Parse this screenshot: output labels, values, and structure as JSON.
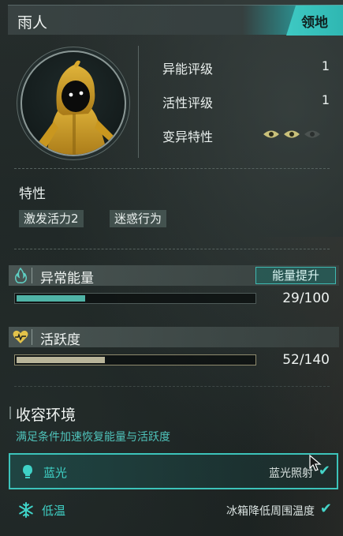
{
  "header": {
    "title": "雨人",
    "tag": "领地"
  },
  "portrait": {
    "icon": "yellow-raincoat-character"
  },
  "stats": [
    {
      "label": "异能评级",
      "value": "1"
    },
    {
      "label": "活性评级",
      "value": "1"
    },
    {
      "label": "变异特性",
      "value": ""
    }
  ],
  "mutation_eyes": {
    "active": 2,
    "total": 3
  },
  "traits": {
    "title": "特性",
    "items": [
      "激发活力2",
      "迷惑行为"
    ]
  },
  "energy": {
    "title": "异常能量",
    "boost_label": "能量提升",
    "current": 29,
    "max": 100,
    "text": "29/100",
    "color": "#4fb3a6",
    "icon": "flame-icon"
  },
  "activity": {
    "title": "活跃度",
    "current": 52,
    "max": 140,
    "text": "52/140",
    "color": "#b9b59a",
    "icon": "heart-pulse-icon"
  },
  "containment": {
    "title": "收容环境",
    "description": "满足条件加速恢复能量与活跃度",
    "conditions": [
      {
        "name": "蓝光",
        "description": "蓝光照射",
        "icon": "lightbulb-icon",
        "met": true,
        "selected": true
      },
      {
        "name": "低温",
        "description": "冰箱降低周围温度",
        "icon": "snowflake-icon",
        "met": true,
        "selected": false
      }
    ]
  },
  "colors": {
    "accent": "#3ec9c3",
    "text": "#e8eeec"
  }
}
